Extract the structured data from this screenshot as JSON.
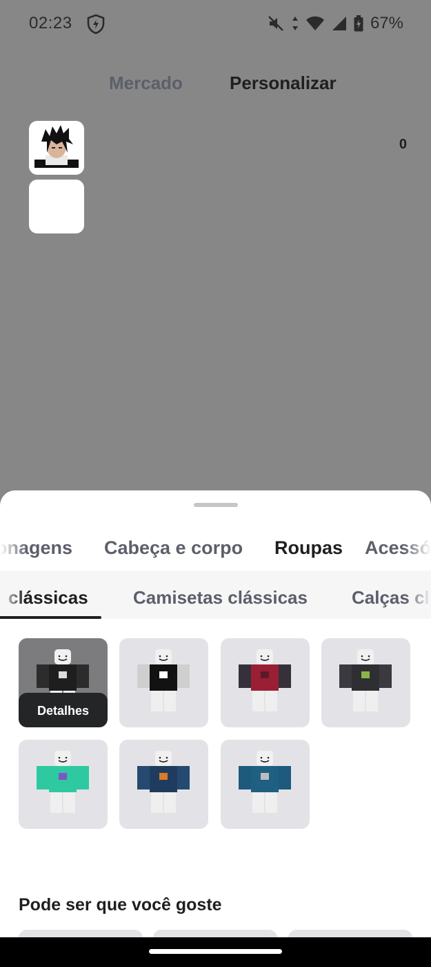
{
  "status_bar": {
    "time": "02:23",
    "battery_percent": "67%",
    "icons": [
      "shield-icon",
      "mute-icon",
      "data-arrows-icon",
      "wifi-icon",
      "cell-signal-icon",
      "battery-charging-icon"
    ]
  },
  "nav": {
    "market": "Mercado",
    "customize": "Personalizar"
  },
  "header": {
    "robux_count": "0"
  },
  "categories": {
    "characters": "onagens",
    "head_body": "Cabeça e corpo",
    "clothing": "Roupas",
    "accessories": "Acessó"
  },
  "subcategories": {
    "classic_shirts": "clássicas",
    "classic_tshirts": "Camisetas clássicas",
    "classic_pants": "Calças cl"
  },
  "items": {
    "details_label": "Detalhes",
    "list": [
      {
        "name": "black-white-shirt",
        "torso": "#1e1e1e",
        "arms": "#2c2c2c",
        "accent": "#dcdcdc"
      },
      {
        "name": "adidas-tank-shirt",
        "torso": "#121212",
        "arms": "#cfcfcf",
        "accent": "#ffffff"
      },
      {
        "name": "red-jacket-shirt",
        "torso": "#9a1f35",
        "arms": "#35303a",
        "accent": "#5a1a2a"
      },
      {
        "name": "black-jacket-shirt",
        "torso": "#2e2e33",
        "arms": "#3a3a40",
        "accent": "#8bb34a"
      },
      {
        "name": "teal-shirt",
        "torso": "#2ec9a0",
        "arms": "#2ec9a0",
        "accent": "#7d55c7"
      },
      {
        "name": "navy-pizza-shirt",
        "torso": "#1f3c5e",
        "arms": "#244a70",
        "accent": "#d97b2a"
      },
      {
        "name": "blue-hoodie-shirt",
        "torso": "#1f5f82",
        "arms": "#1d5a7c",
        "accent": "#bdbdbd"
      }
    ]
  },
  "recommend": {
    "title": "Pode ser que você goste"
  },
  "colors": {
    "background_dim": "#878787",
    "sheet": "#ffffff",
    "accent_dark": "#1f1f1f",
    "muted_text": "#5c5f6b",
    "tile_bg": "#e3e3e7"
  }
}
